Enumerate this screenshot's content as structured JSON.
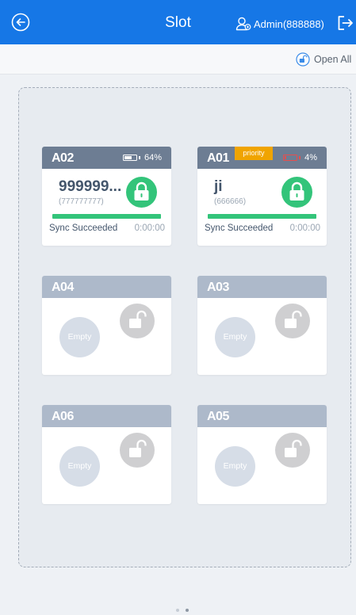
{
  "header": {
    "title": "Slot",
    "user": "Admin(888888)"
  },
  "toolbar": {
    "open_all_label": "Open All"
  },
  "slots": {
    "a02": {
      "id": "A02",
      "battery": "64%",
      "battery_level": 0.64,
      "name": "999999...",
      "code": "(777777777)",
      "sync_status": "Sync Succeeded",
      "sync_time": "0:00:00",
      "progress": 1.0
    },
    "a01": {
      "id": "A01",
      "badge": "priority",
      "battery": "4%",
      "battery_level": 0.04,
      "name": "ji",
      "code": "(666666)",
      "sync_status": "Sync Succeeded",
      "sync_time": "0:00:00",
      "progress": 1.0
    },
    "a04": {
      "id": "A04",
      "empty_label": "Empty"
    },
    "a03": {
      "id": "A03",
      "empty_label": "Empty"
    },
    "a06": {
      "id": "A06",
      "empty_label": "Empty"
    },
    "a05": {
      "id": "A05",
      "empty_label": "Empty"
    }
  },
  "pagination": {
    "current": 2,
    "total": 2
  },
  "colors": {
    "primary": "#1677e6",
    "locked": "#33c47a",
    "priority": "#f0a400",
    "battery_low": "#e84e4e"
  },
  "icons": {
    "back": "arrow-left-circle-icon",
    "user": "user-icon",
    "logout": "logout-icon",
    "open_all": "unlock-circle-icon",
    "lock": "lock-icon",
    "unlock": "unlock-icon",
    "battery": "battery-icon"
  }
}
